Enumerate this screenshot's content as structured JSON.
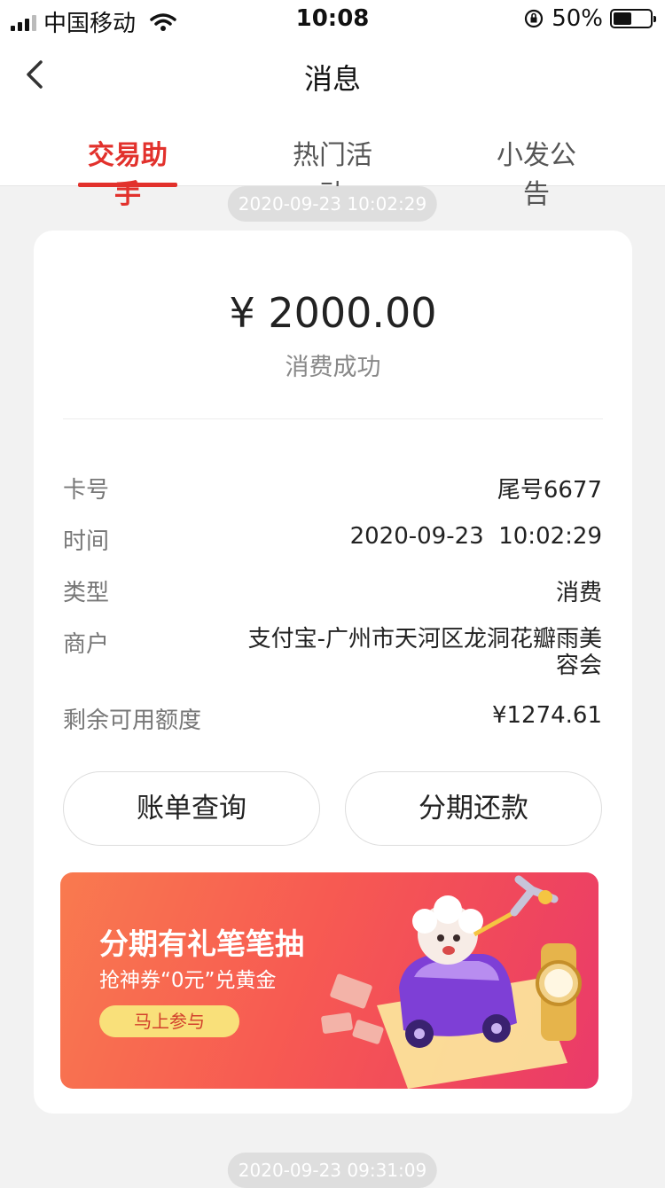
{
  "status_bar": {
    "carrier": "中国移动",
    "time": "10:08",
    "battery_percent": "50%",
    "battery_level": 0.5
  },
  "nav": {
    "title": "消息",
    "back_icon": "chevron-left-icon"
  },
  "tabs": [
    {
      "label": "交易助手",
      "active": true
    },
    {
      "label": "热门活动",
      "active": false
    },
    {
      "label": "小发公告",
      "active": false
    }
  ],
  "messages": [
    {
      "timestamp": "2020-09-23 10:02:29",
      "amount": "¥ 2000.00",
      "status": "消费成功",
      "details": [
        {
          "label": "卡号",
          "value": "尾号6677"
        },
        {
          "label": "时间",
          "value": "2020-09-23  10:02:29"
        },
        {
          "label": "类型",
          "value": "消费"
        },
        {
          "label": "商户",
          "value": "支付宝-广州市天河区龙洞花瓣雨美容会"
        },
        {
          "label": "剩余可用额度",
          "value": "¥1274.61"
        }
      ],
      "buttons": {
        "bill_query": "账单查询",
        "installment_repay": "分期还款"
      },
      "banner": {
        "title": "分期有礼笔笔抽",
        "subtitle": "抢神券“0元”兑黄金",
        "cta": "马上参与"
      }
    },
    {
      "timestamp": "2020-09-23 09:31:09"
    }
  ],
  "colors": {
    "accent": "#e2312c",
    "background": "#f2f2f2",
    "banner_cta": "#f9e07a"
  }
}
